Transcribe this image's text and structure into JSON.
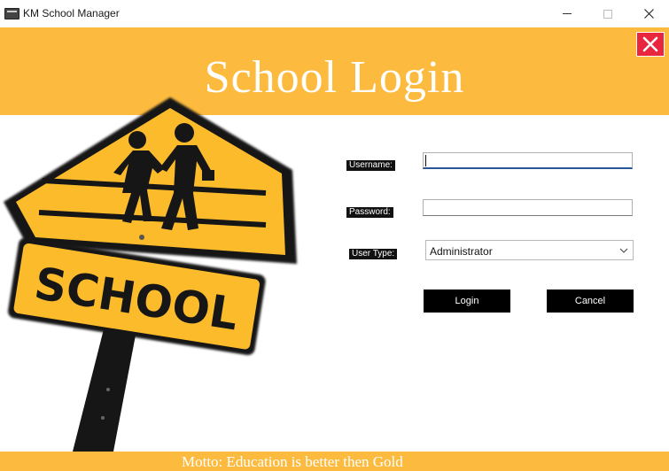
{
  "window": {
    "title": "KM School Manager",
    "icons": {
      "app": "app-window-icon",
      "minimize": "minimize-icon",
      "maximize": "maximize-icon",
      "close": "close-icon"
    }
  },
  "header": {
    "title": "School Login",
    "close_icon": "close-x-icon",
    "colors": {
      "banner": "#fcbb3f",
      "close_button": "#e8273f"
    }
  },
  "illustration": {
    "sign_text": "SCHOOL",
    "icon": "school-crossing-sign-icon"
  },
  "form": {
    "username_label": "Username:",
    "username_value": "",
    "password_label": "Password:",
    "password_value": "",
    "usertype_label": "User Type:",
    "usertype_selected": "Administrator",
    "login_label": "Login",
    "cancel_label": "Cancel"
  },
  "footer": {
    "motto": "Motto:  Education is better then Gold"
  }
}
